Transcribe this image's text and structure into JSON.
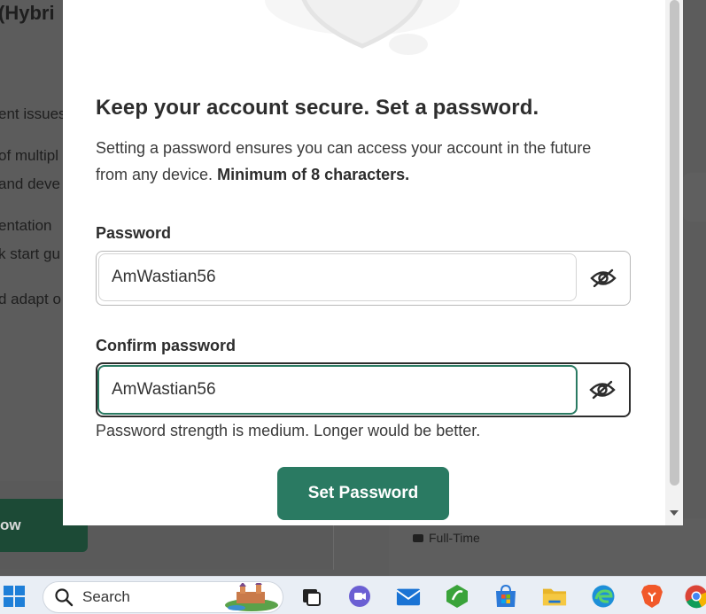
{
  "background": {
    "partial_title": "(Hybri",
    "lines": [
      "ent issues",
      "of multipl",
      "and deve",
      "entation",
      "k start gu",
      "d adapt o"
    ],
    "cta_label": "ow",
    "job_type": "Full-Time"
  },
  "modal": {
    "heading": "Keep your account secure. Set a password.",
    "description": "Setting a password ensures you can access your account in the future from any device.",
    "description_bold": "Minimum of 8 characters.",
    "password": {
      "label": "Password",
      "value": "AmWastian56",
      "toggle_icon": "eye-off-icon"
    },
    "confirm_password": {
      "label": "Confirm password",
      "value": "AmWastian56",
      "toggle_icon": "eye-off-icon"
    },
    "strength_hint": "Password strength is medium. Longer would be better.",
    "submit_label": "Set Password"
  },
  "taskbar": {
    "search_placeholder": "Search",
    "icons": [
      "windows-start-icon",
      "search-icon",
      "castle-widget-icon",
      "task-view-icon",
      "teams-icon",
      "mail-icon",
      "dev-app-icon",
      "store-icon",
      "file-explorer-icon",
      "edge-icon",
      "brave-icon",
      "chrome-icon"
    ]
  },
  "colors": {
    "accent": "#2a7a62",
    "overlay": "#5c5c5c",
    "text": "#2d2d2d"
  }
}
